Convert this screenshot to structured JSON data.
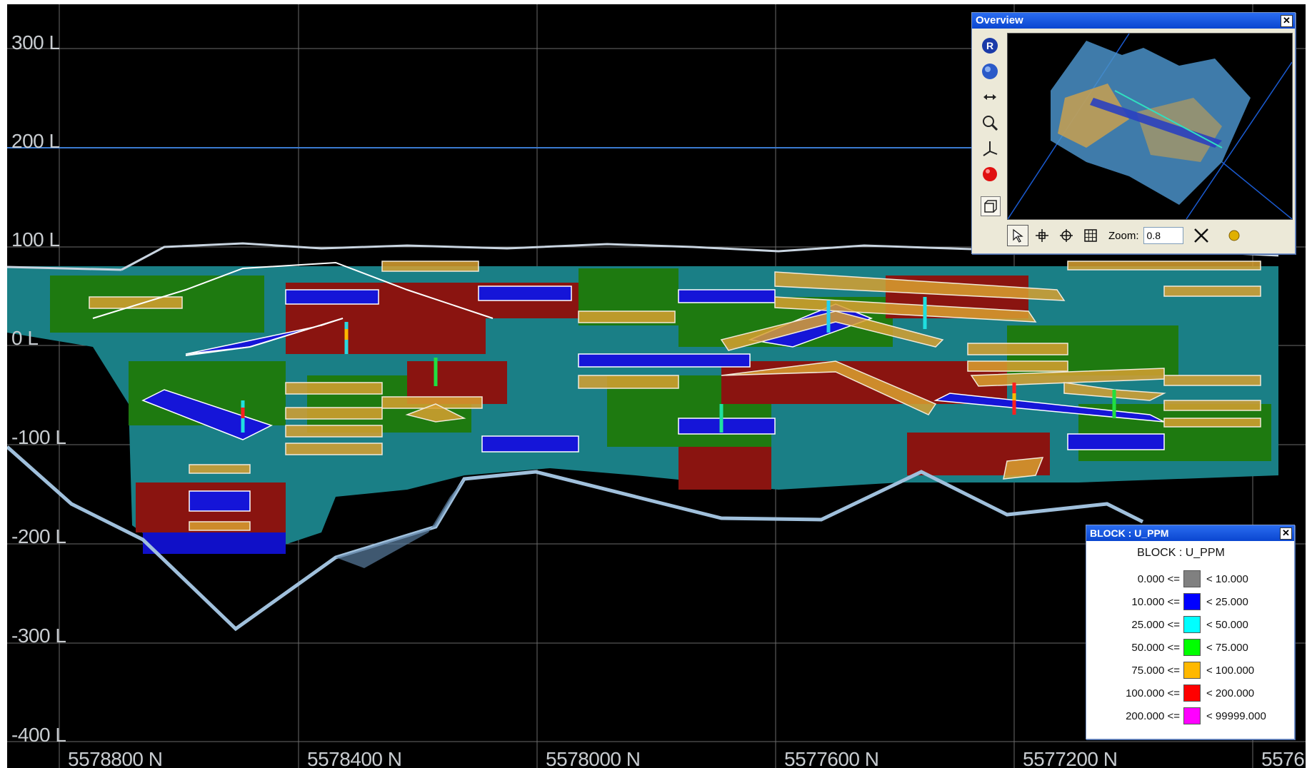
{
  "section_view": {
    "elevation_labels": [
      "300 L",
      "200 L",
      "100 L",
      "0 L",
      "-100 L",
      "-200 L",
      "-300 L",
      "-400 L"
    ],
    "northing_labels": [
      "5578800 N",
      "5578400 N",
      "5578000 N",
      "5577600 N",
      "5577200 N",
      "5576"
    ]
  },
  "overview": {
    "title": "Overview",
    "close_glyph": "✕",
    "zoom_label": "Zoom:",
    "zoom_value": "0.8",
    "tools": [
      "rotate-icon",
      "globe-icon",
      "pan-arrows-icon",
      "magnifier-icon",
      "axis-icon",
      "red-sphere-icon",
      "box-view-icon"
    ],
    "bottom_tools": [
      "select-arrow-icon",
      "crosshair-icon",
      "target-icon",
      "grid-icon",
      "reset-x-icon",
      "light-icon"
    ]
  },
  "legend": {
    "title": "BLOCK : U_PPM",
    "heading": "BLOCK : U_PPM",
    "close_glyph": "✕",
    "rows": [
      {
        "lo": "0.000 <=",
        "hi": "< 10.000",
        "color": "#808080"
      },
      {
        "lo": "10.000 <=",
        "hi": "< 25.000",
        "color": "#0000ff"
      },
      {
        "lo": "25.000 <=",
        "hi": "< 50.000",
        "color": "#00ffff"
      },
      {
        "lo": "50.000 <=",
        "hi": "< 75.000",
        "color": "#00ff00"
      },
      {
        "lo": "75.000 <=",
        "hi": "< 100.000",
        "color": "#ffb800"
      },
      {
        "lo": "100.000 <=",
        "hi": "< 200.000",
        "color": "#ff0000"
      },
      {
        "lo": "200.000 <=",
        "hi": "< 99999.000",
        "color": "#ff00ff"
      }
    ]
  },
  "colors": {
    "grade_teal": "#1a7f86",
    "grade_green": "#1e7a10",
    "grade_red": "#8a1410",
    "grade_blue": "#1010c8",
    "grade_orange": "#d8a030",
    "outline": "#e8e0d0",
    "topo": "#b0c4d8"
  }
}
